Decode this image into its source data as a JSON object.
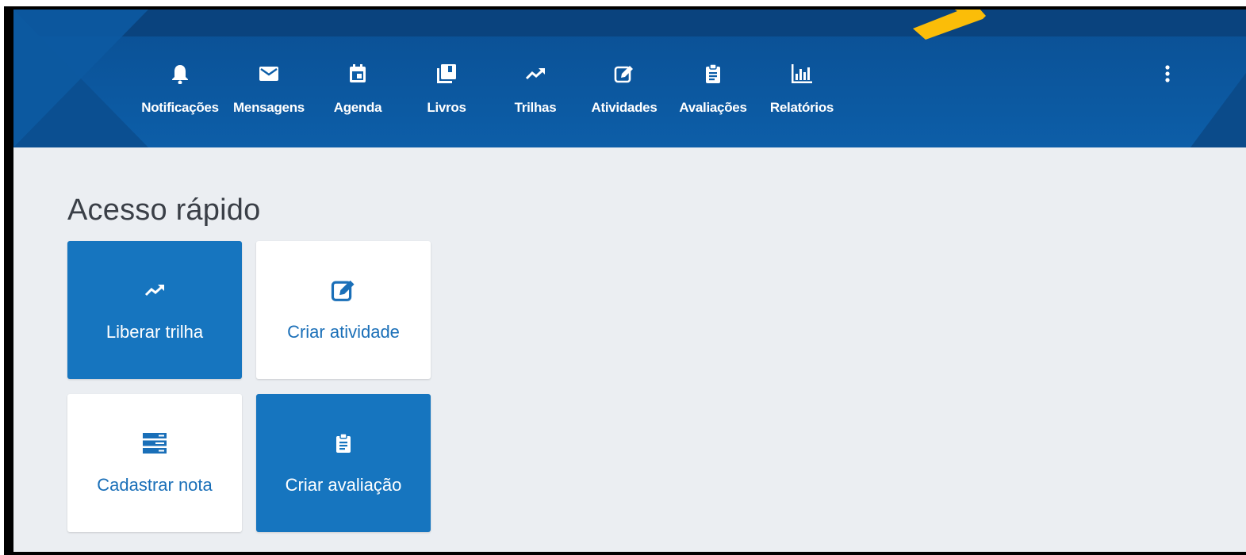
{
  "nav": {
    "items": [
      {
        "label": "Notificações",
        "icon": "bell-icon"
      },
      {
        "label": "Mensagens",
        "icon": "envelope-icon"
      },
      {
        "label": "Agenda",
        "icon": "calendar-icon"
      },
      {
        "label": "Livros",
        "icon": "books-icon"
      },
      {
        "label": "Trilhas",
        "icon": "trending-up-icon"
      },
      {
        "label": "Atividades",
        "icon": "edit-icon"
      },
      {
        "label": "Avaliações",
        "icon": "clipboard-icon"
      },
      {
        "label": "Relatórios",
        "icon": "bar-chart-icon"
      }
    ],
    "more_icon": "more-vertical-icon"
  },
  "quick_access": {
    "title": "Acesso rápido",
    "tiles": [
      {
        "label": "Liberar trilha",
        "icon": "trending-up-icon",
        "style": "blue"
      },
      {
        "label": "Criar atividade",
        "icon": "edit-icon",
        "style": "white"
      },
      {
        "label": "Cadastrar nota",
        "icon": "grade-list-icon",
        "style": "white"
      },
      {
        "label": "Criar avaliação",
        "icon": "clipboard-icon",
        "style": "blue"
      }
    ]
  },
  "colors": {
    "header": "#0d5ea8",
    "tile_blue": "#1675bf",
    "tile_text_blue": "#1a6fb8",
    "background": "#ebeef2",
    "arrow": "#fbbd08"
  }
}
